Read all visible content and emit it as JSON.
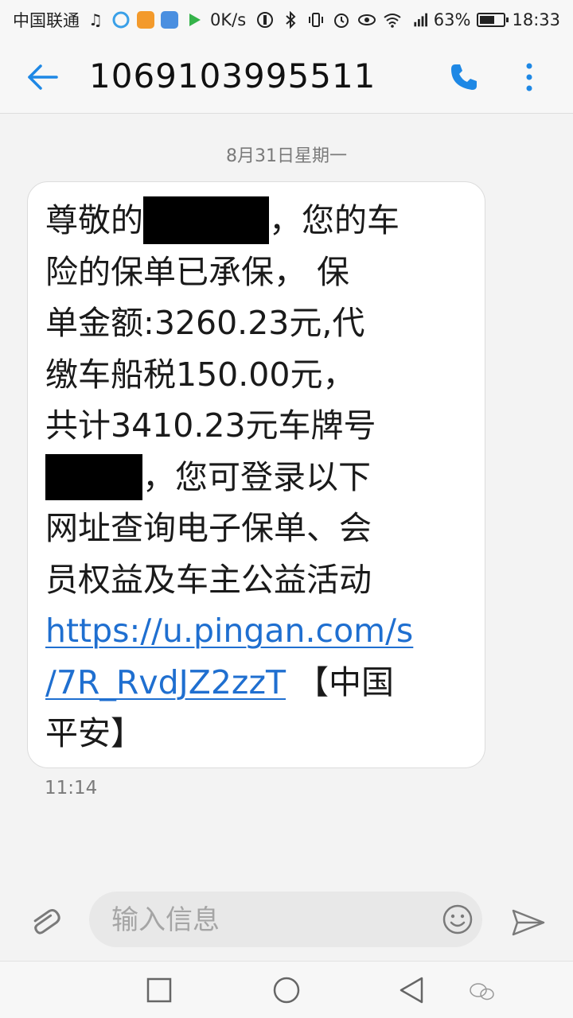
{
  "status_bar": {
    "carrier": "中国联通",
    "network_speed": "0K/s",
    "battery_level": "63%",
    "battery_fraction": 0.63,
    "time": "18:33",
    "icons": [
      "music-note-icon",
      "app-icon-1",
      "app-icon-2",
      "app-icon-3",
      "play-icon",
      "data-saver-icon",
      "bluetooth-icon",
      "vibrate-icon",
      "alarm-icon",
      "eye-icon",
      "wifi-icon",
      "signal-4g-icon",
      "battery-icon"
    ]
  },
  "header": {
    "title": "1069103995511",
    "back_icon": "back-arrow-icon",
    "call_icon": "phone-icon",
    "more_icon": "more-vert-icon",
    "accent_color": "#1e88e5"
  },
  "conversation": {
    "date_label": "8月31日星期一",
    "message": {
      "line1_start": "尊敬的",
      "line1_end": "，您的车",
      "line2": "险的保单已承保， 保",
      "line3": "单金额:3260.23元,代",
      "line4": "缴车船税150.00元，",
      "line5": "共计3410.23元车牌号",
      "line6_end": "，您可登录以下",
      "line7": "网址查询电子保单、会",
      "line8": "员权益及车主公益活动",
      "link_line1": "https://u.pingan.com/s",
      "link_line2": "/7R_RvdJZ2zzT",
      "line9_end": " 【中国",
      "line10": "平安】",
      "link_color": "#1f6fd0"
    },
    "time": "11:14"
  },
  "composer": {
    "placeholder": "输入信息",
    "attach_icon": "paperclip-icon",
    "emoji_icon": "emoji-icon",
    "send_icon": "send-icon"
  },
  "nav_bar": {
    "icons": [
      "recents-square-icon",
      "home-circle-icon",
      "back-triangle-icon"
    ]
  }
}
